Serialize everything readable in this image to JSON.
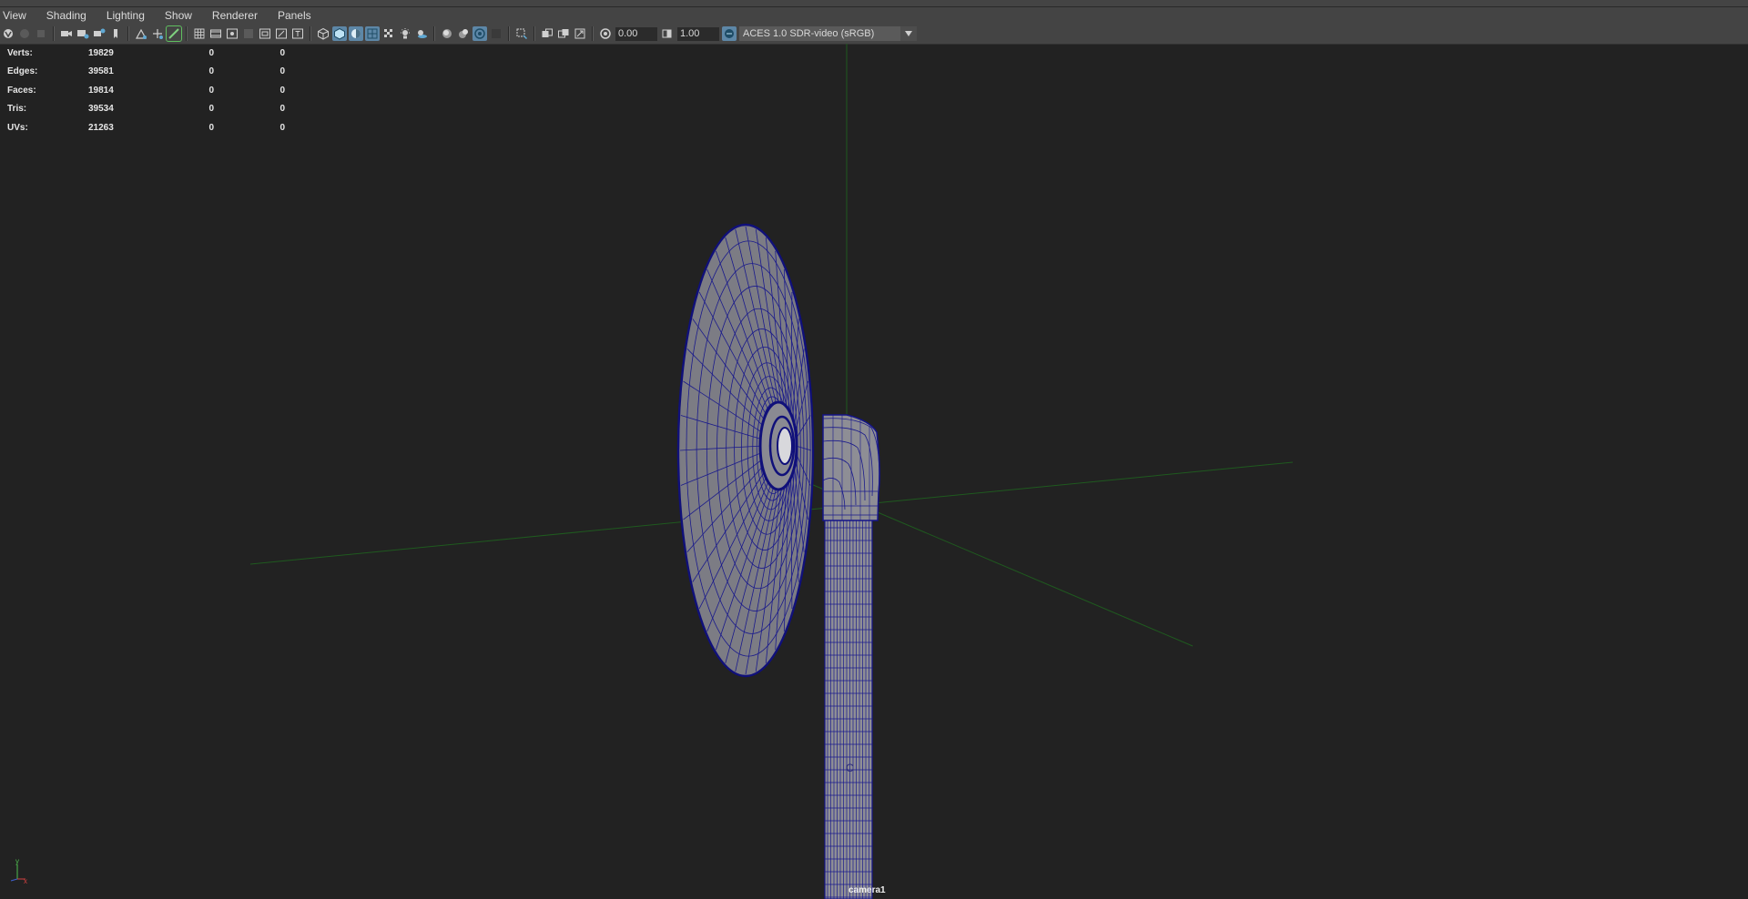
{
  "menu": [
    "View",
    "Shading",
    "Lighting",
    "Show",
    "Renderer",
    "Panels"
  ],
  "toolbar": {
    "exposure_value": "0.00",
    "gamma_value": "1.00",
    "color_space": "ACES 1.0 SDR-video (sRGB)"
  },
  "hud": {
    "rows": [
      {
        "label": "Verts:",
        "v1": "19829",
        "v2": "0",
        "v3": "0"
      },
      {
        "label": "Edges:",
        "v1": "39581",
        "v2": "0",
        "v3": "0"
      },
      {
        "label": "Faces:",
        "v1": "19814",
        "v2": "0",
        "v3": "0"
      },
      {
        "label": "Tris:",
        "v1": "39534",
        "v2": "0",
        "v3": "0"
      },
      {
        "label": "UVs:",
        "v1": "21263",
        "v2": "0",
        "v3": "0"
      }
    ]
  },
  "viewport": {
    "camera_label": "camera1",
    "pivot_label": "C",
    "axis_labels": {
      "y": "y",
      "x": "x"
    }
  },
  "colors": {
    "background": "#222222",
    "wireframe": "#14148a",
    "surface": "#8a8a90",
    "grid_axis": "#1f5a1f",
    "panel": "#444444"
  }
}
